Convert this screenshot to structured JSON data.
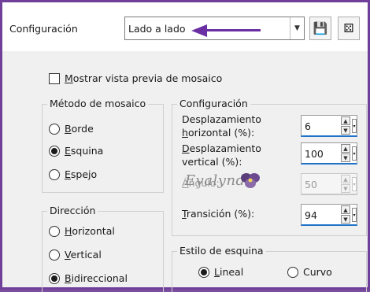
{
  "header": {
    "preset_label": "Configuración",
    "preset_value": "Lado a lado",
    "save_icon": "save-icon",
    "reset_icon": "dice-icon"
  },
  "checkbox": {
    "label_u": "M",
    "label_rest": "ostrar vista previa de mosaico",
    "checked": false
  },
  "method_group": {
    "title": "Método de mosaico",
    "options": [
      {
        "u": "B",
        "rest": "orde",
        "selected": false
      },
      {
        "u": "E",
        "rest": "squina",
        "selected": true
      },
      {
        "u": "E",
        "rest": "spejo",
        "selected": false
      }
    ]
  },
  "direction_group": {
    "title": "Dirección",
    "options": [
      {
        "u": "H",
        "rest": "orizontal",
        "selected": false
      },
      {
        "u": "V",
        "rest": "ertical",
        "selected": false
      },
      {
        "u": "B",
        "rest": "idireccional",
        "selected": true
      }
    ]
  },
  "settings_group": {
    "title": "Configuración",
    "fields": [
      {
        "line1": "Desplazamiento",
        "line2_u": "h",
        "line2_rest": "orizontal (%):",
        "value": "6",
        "enabled": true
      },
      {
        "line1_u": "D",
        "line1_rest": "esplazamiento",
        "line2": "vertical (%):",
        "value": "100",
        "enabled": true
      },
      {
        "label_u": "Á",
        "label_rest": "ngulo:",
        "value": "50",
        "enabled": false
      },
      {
        "label_u": "T",
        "label_rest": "ransición (%):",
        "value": "94",
        "enabled": true
      }
    ]
  },
  "corner_group": {
    "title": "Estilo de esquina",
    "options": [
      {
        "u": "L",
        "rest": "ineal",
        "selected": true
      },
      {
        "u": "",
        "rest": "Curvo",
        "selected": false
      }
    ]
  },
  "watermark": {
    "text": "Evalynda"
  },
  "colors": {
    "frame": "#6f3f9a",
    "arrow": "#6a2fa2",
    "accent": "#1e73c8"
  }
}
